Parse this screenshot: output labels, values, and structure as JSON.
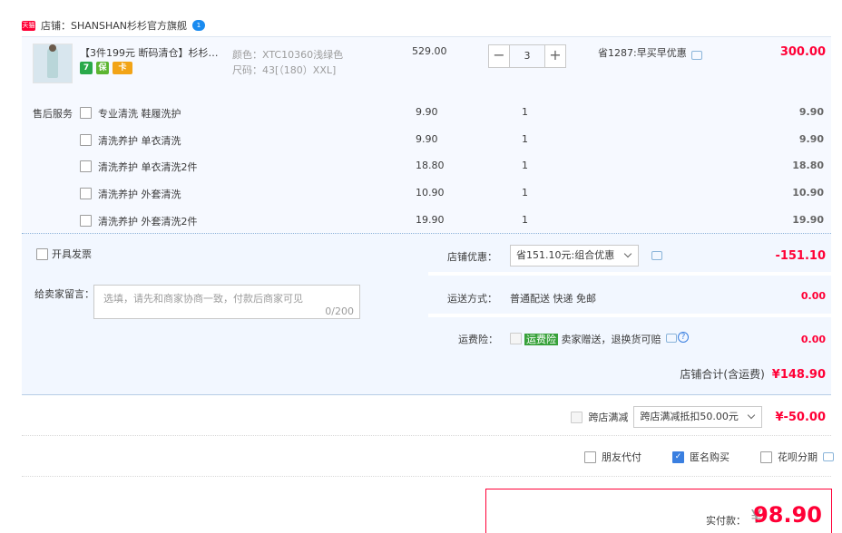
{
  "shop": {
    "badge": "天猫",
    "label": "店铺：",
    "name": "SHANSHAN杉杉官方旗舰",
    "chat_badge": "1"
  },
  "item": {
    "title": "【3件199元 断码清仓】杉杉宽...",
    "service_icons": [
      "7",
      "保",
      "卡"
    ],
    "color_label": "颜色：",
    "color_value": "XTC10360浅绿色",
    "size_label": "尺码：",
    "size_value": "43[（180）XXL]",
    "price": "529.00",
    "quantity": "3",
    "qty_minus": "−",
    "qty_plus": "+",
    "promo": "省1287:早买早优惠",
    "subtotal": "300.00"
  },
  "after_sales": {
    "title": "售后服务",
    "rows": [
      {
        "name": "专业清洗 鞋履洗护",
        "price": "9.90",
        "qty": "1",
        "subtotal": "9.90"
      },
      {
        "name": "清洗养护 单衣清洗",
        "price": "9.90",
        "qty": "1",
        "subtotal": "9.90"
      },
      {
        "name": "清洗养护 单衣清洗2件",
        "price": "18.80",
        "qty": "1",
        "subtotal": "18.80"
      },
      {
        "name": "清洗养护 外套清洗",
        "price": "10.90",
        "qty": "1",
        "subtotal": "10.90"
      },
      {
        "name": "清洗养护 外套清洗2件",
        "price": "19.90",
        "qty": "1",
        "subtotal": "19.90"
      }
    ]
  },
  "invoice": {
    "label": "开具发票"
  },
  "message": {
    "label": "给卖家留言：",
    "placeholder": "选填，请先和商家协商一致，付款后商家可见",
    "count": "0/200"
  },
  "shop_discount": {
    "label": "店铺优惠：",
    "selected": "省151.10元:组合优惠",
    "value": "-151.10"
  },
  "shipping": {
    "label": "运送方式：",
    "value_text": "普通配送 快递 免邮",
    "value": "0.00"
  },
  "insurance": {
    "label": "运费险：",
    "tag": "运费险",
    "text": "卖家赠送，退换货可赔",
    "value": "0.00"
  },
  "shop_total": {
    "label": "店铺合计(含运费)",
    "value": "¥148.90"
  },
  "cross_store": {
    "label": "跨店满减",
    "selected": "跨店满减抵扣50.00元",
    "value": "¥-50.00"
  },
  "options": {
    "friend_pay": "朋友代付",
    "anonymous": "匿名购买",
    "installment": "花呗分期"
  },
  "payment": {
    "label": "实付款：",
    "currency": "¥",
    "amount": "98.90"
  }
}
